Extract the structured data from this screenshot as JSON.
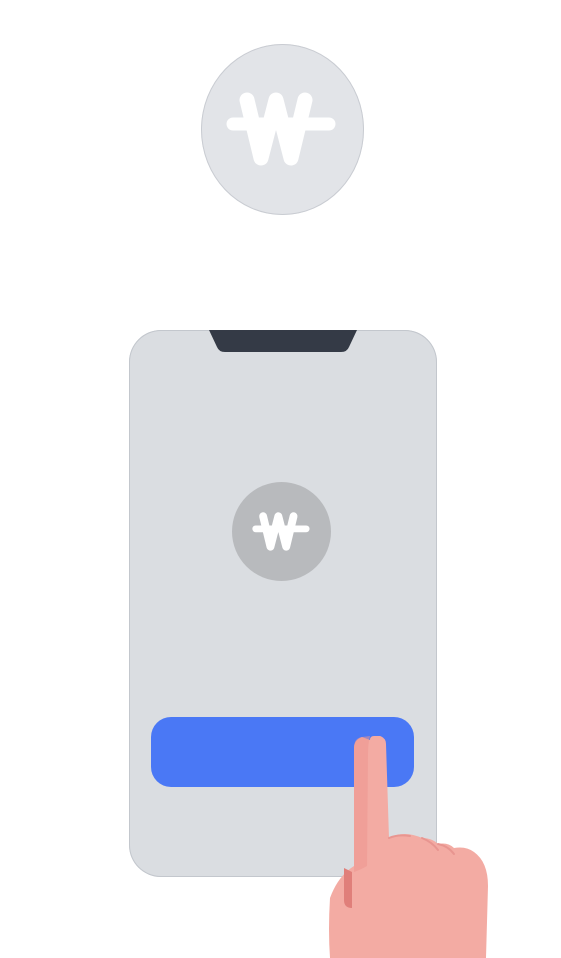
{
  "app": {
    "logo_icon": "won-sign-icon",
    "logo_color": "#ffffff"
  },
  "top_logo": {
    "icon": "won-sign-icon",
    "background": "#e2e4e8"
  },
  "phone": {
    "screen_color": "#dadde1",
    "notch_color": "#343a46",
    "logo": {
      "icon": "won-sign-icon",
      "background": "#b8babd"
    },
    "primary_button": {
      "label": "",
      "color": "#4a78f5"
    }
  },
  "hand": {
    "icon": "pointing-hand-icon",
    "skin_color": "#f3aba3",
    "shadow_color": "#e07f7a"
  }
}
